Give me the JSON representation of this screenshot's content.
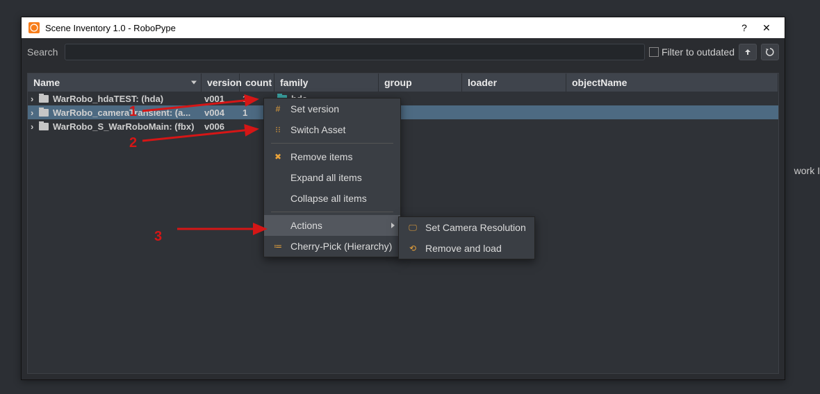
{
  "window": {
    "title": "Scene Inventory 1.0 - RoboPype",
    "help_label": "?",
    "close_label": "✕"
  },
  "search": {
    "label": "Search",
    "value": "",
    "placeholder": "",
    "filter_label": "Filter to outdated"
  },
  "columns": {
    "name": "Name",
    "version": "version",
    "count": "count",
    "family": "family",
    "group": "group",
    "loader": "loader",
    "objectName": "objectName"
  },
  "rows": [
    {
      "name": "WarRobo_hdaTEST: (hda)",
      "version": "v001",
      "count": "1",
      "family": "hda",
      "family_icon": "teal"
    },
    {
      "name": "WarRobo_cameraTransient: (a...",
      "version": "v004",
      "count": "1",
      "family": "",
      "selected": true
    },
    {
      "name": "WarRobo_S_WarRoboMain: (fbx)",
      "version": "v006",
      "count": "",
      "family": ""
    }
  ],
  "context_menu": {
    "items": [
      {
        "icon": "#",
        "label": "Set version",
        "icon_name": "hash-icon"
      },
      {
        "icon": "⁝⁝",
        "label": "Switch Asset",
        "icon_name": "sitemap-icon"
      },
      {
        "sep": true
      },
      {
        "icon": "✖",
        "label": "Remove items",
        "icon_name": "remove-icon"
      },
      {
        "icon": "",
        "label": "Expand all items"
      },
      {
        "icon": "",
        "label": "Collapse all items"
      },
      {
        "sep": true
      },
      {
        "icon": "",
        "label": "Actions",
        "has_sub": true,
        "hover": true
      },
      {
        "icon": "≔",
        "label": "Cherry-Pick (Hierarchy)",
        "icon_name": "list-icon"
      }
    ]
  },
  "submenu": {
    "items": [
      {
        "icon": "🖵",
        "label": "Set Camera Resolution",
        "icon_name": "monitor-icon"
      },
      {
        "icon": "⟲",
        "label": "Remove and load",
        "icon_name": "reload-icon"
      }
    ]
  },
  "annotations": {
    "a1": "1",
    "a2": "2",
    "a3": "3"
  },
  "background_text": "work I"
}
